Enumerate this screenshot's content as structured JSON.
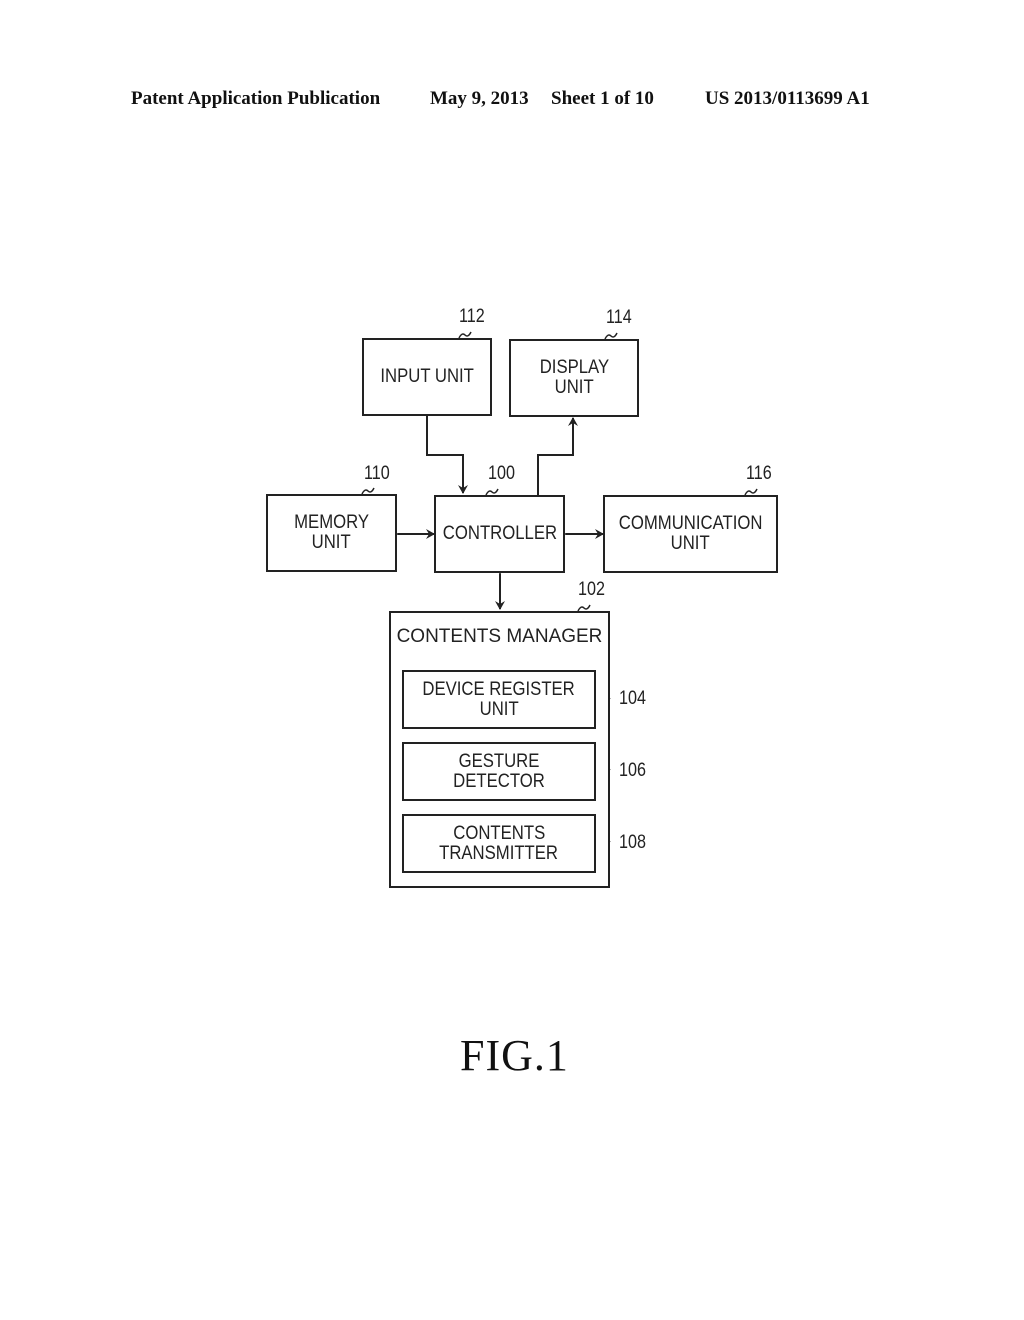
{
  "header": {
    "publication": "Patent Application Publication",
    "date": "May 9, 2013",
    "sheet": "Sheet 1 of 10",
    "number": "US 2013/0113699 A1"
  },
  "blocks": {
    "input_unit": {
      "label": "INPUT UNIT",
      "ref": "112"
    },
    "display_unit": {
      "line1": "DISPLAY",
      "line2": "UNIT",
      "ref": "114"
    },
    "memory_unit": {
      "line1": "MEMORY",
      "line2": "UNIT",
      "ref": "110"
    },
    "controller": {
      "label": "CONTROLLER",
      "ref": "100"
    },
    "communication_unit": {
      "line1": "COMMUNICATION",
      "line2": "UNIT",
      "ref": "116"
    },
    "contents_manager": {
      "label": "CONTENTS MANAGER",
      "ref": "102"
    },
    "device_register_unit": {
      "line1": "DEVICE REGISTER",
      "line2": "UNIT",
      "ref": "104"
    },
    "gesture_detector": {
      "label": "GESTURE DETECTOR",
      "ref": "106"
    },
    "contents_transmitter": {
      "line1": "CONTENTS",
      "line2": "TRANSMITTER",
      "ref": "108"
    }
  },
  "figure_label": "FIG.1"
}
